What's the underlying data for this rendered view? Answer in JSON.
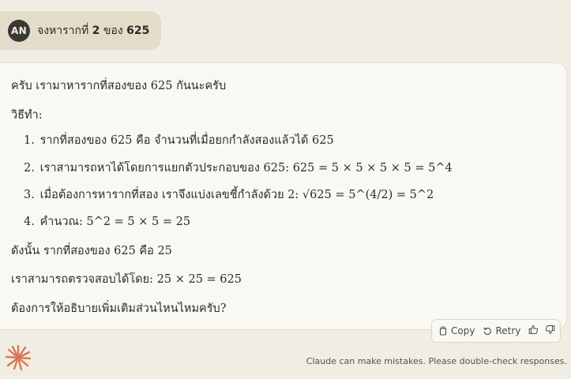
{
  "user_message": {
    "avatar_initials": "AN",
    "text_prefix": "จงหารากที่ ",
    "text_number": "2",
    "text_middle": " ของ ",
    "text_value": "625"
  },
  "response": {
    "intro": "ครับ เรามาหารากที่สองของ 625 กันนะครับ",
    "method_heading": "วิธีทำ:",
    "steps": [
      {
        "num": "1.",
        "text": "รากที่สองของ 625 คือ จำนวนที่เมื่อยกกำลังสองแล้วได้ 625"
      },
      {
        "num": "2.",
        "text": "เราสามารถหาได้โดยการแยกตัวประกอบของ 625: 625 = 5 × 5 × 5 × 5 = 5^4"
      },
      {
        "num": "3.",
        "text": "เมื่อต้องการหารากที่สอง เราจึงแบ่งเลขชี้กำลังด้วย 2: √625 = 5^(4/2) = 5^2"
      },
      {
        "num": "4.",
        "text": "คำนวณ: 5^2 = 5 × 5 = 25"
      }
    ],
    "conclusion": "ดังนั้น รากที่สองของ 625 คือ 25",
    "verification": "เราสามารถตรวจสอบได้โดย: 25 × 25 = 625",
    "closing": "ต้องการให้อธิบายเพิ่มเติมส่วนไหนไหมครับ?"
  },
  "actions": {
    "copy_label": "Copy",
    "retry_label": "Retry",
    "icons": [
      "copy-icon",
      "retry-icon",
      "thumbs-up-icon",
      "thumbs-down-icon"
    ]
  },
  "footer": {
    "disclaimer": "Claude can make mistakes. Please double-check responses."
  },
  "colors": {
    "background": "#f0ede4",
    "user_bubble": "#e4dccb",
    "card": "#faf8f3",
    "logo": "#d97757"
  }
}
